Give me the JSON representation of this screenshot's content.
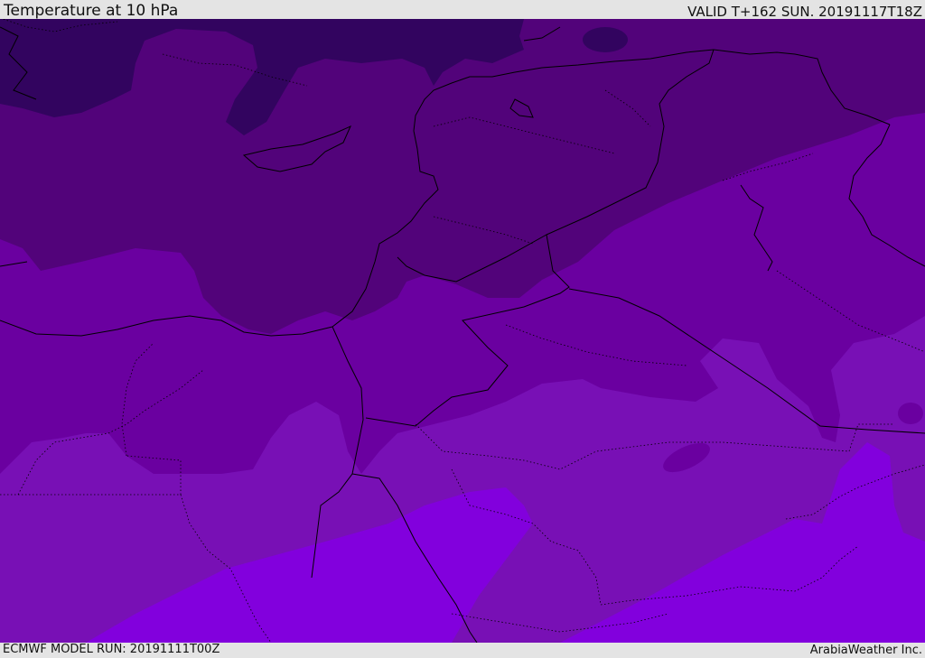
{
  "header": {
    "title": "Temperature at 10 hPa",
    "valid": "VALID T+162 SUN. 20191117T18Z"
  },
  "footer": {
    "model_run": "ECMWF MODEL RUN: 20191111T00Z",
    "credit": "ArabiaWeather Inc."
  },
  "map": {
    "colors": {
      "band_coldest": "#32045f",
      "band_cold": "#52037a",
      "band_mid": "#6a00a0",
      "band_warm": "#7810b5",
      "band_warmest": "#8200dd",
      "lines": "#000000"
    }
  }
}
